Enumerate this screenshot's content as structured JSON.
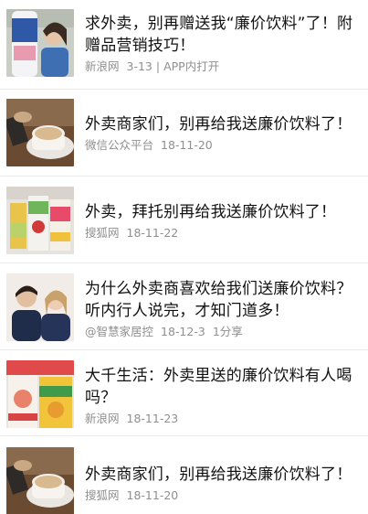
{
  "items": [
    {
      "title": "求外卖，别再赠送我“廉价饮料”了！附赠品营销技巧！",
      "source": "新浪网",
      "date": "3-13",
      "extra": "| APP内打开",
      "thumb": "juice-bottle-woman-photo"
    },
    {
      "title": "外卖商家们，别再给我送廉价饮料了！",
      "source": "微信公众平台",
      "date": "18-11-20",
      "extra": "",
      "thumb": "milk-tea-cup-photo"
    },
    {
      "title": "外卖，拜托别再给我送廉价饮料了！",
      "source": "搜狐网",
      "date": "18-11-22",
      "extra": "",
      "thumb": "juice-cartons-photo"
    },
    {
      "title": "为什么外卖商喜欢给我们送廉价饮料？听内行人说完，才知门道多！",
      "source": "@智慧家居控",
      "date": "18-12-3",
      "extra": "1分享",
      "thumb": "couple-portrait-photo"
    },
    {
      "title": "大千生活：外卖里送的廉价饮料有人喝吗？",
      "source": "新浪网",
      "date": "18-11-23",
      "extra": "",
      "thumb": "mango-juice-boxes-photo"
    },
    {
      "title": "外卖商家们，别再给我送廉价饮料了！",
      "source": "搜狐网",
      "date": "18-11-20",
      "extra": "",
      "thumb": "milk-tea-cup-photo"
    }
  ]
}
